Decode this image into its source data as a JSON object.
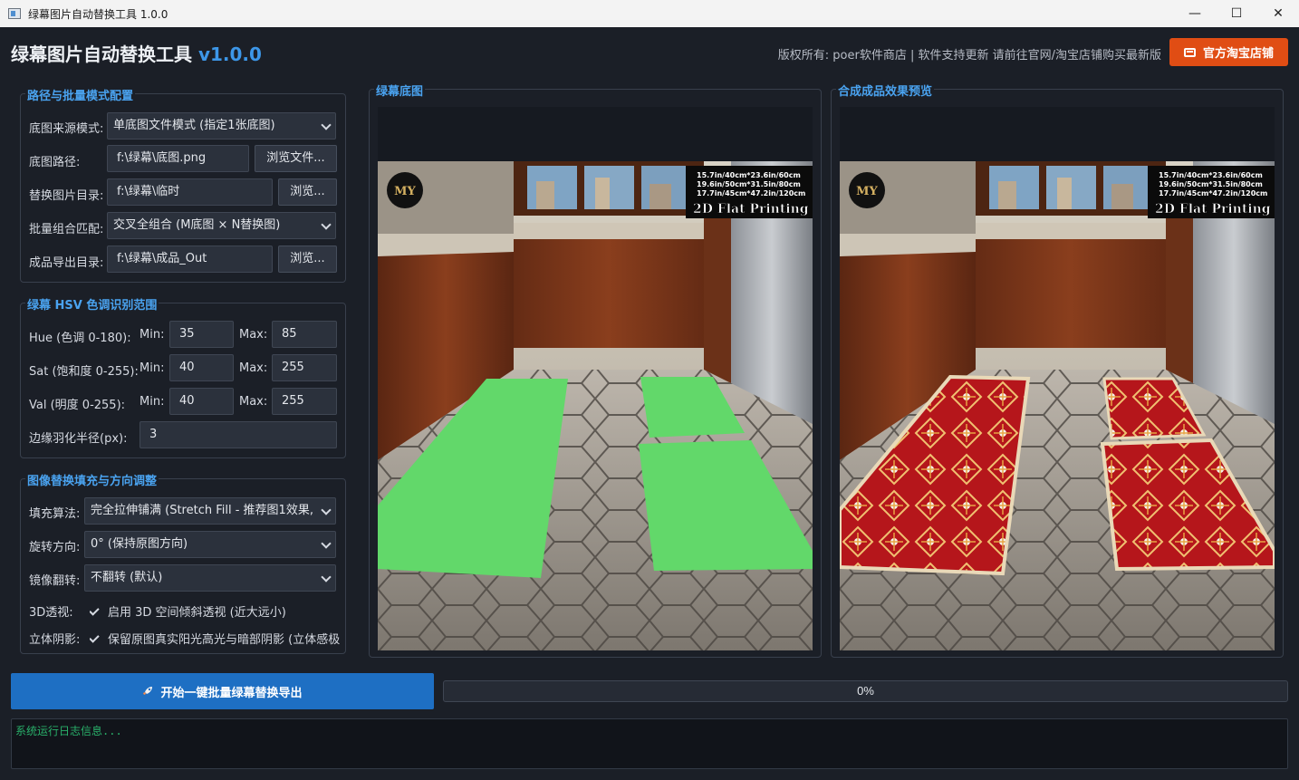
{
  "window": {
    "title": "绿幕图片自动替换工具 1.0.0",
    "controls": {
      "minimize": "—",
      "maximize": "☐",
      "close": "✕"
    }
  },
  "header": {
    "title": "绿幕图片自动替换工具",
    "version": "v1.0.0",
    "copyright": "版权所有: poer软件商店 | 软件支持更新 请前往官网/淘宝店铺购买最新版",
    "shop_button": "官方淘宝店铺",
    "shop_icon": "ticket-icon",
    "accent_color": "#3d97e8",
    "shop_color": "#e04d14"
  },
  "path_config": {
    "title": "路径与批量模式配置",
    "base_mode_label": "底图来源模式:",
    "base_mode_value": "单底图文件模式 (指定1张底图)",
    "base_path_label": "底图路径:",
    "base_path_value": "f:\\绿幕\\底图.png",
    "browse_file_label": "浏览文件...",
    "replace_dir_label": "替换图片目录:",
    "replace_dir_value": "f:\\绿幕\\临时",
    "browse_label": "浏览...",
    "batch_label": "批量组合匹配:",
    "batch_value": "交叉全组合 (M底图 × N替换图)",
    "output_dir_label": "成品导出目录:",
    "output_dir_value": "f:\\绿幕\\成品_Out"
  },
  "hsv": {
    "title": "绿幕 HSV 色调识别范围",
    "min_label": "Min:",
    "max_label": "Max:",
    "hue_label": "Hue (色调 0-180):",
    "hue_min": "35",
    "hue_max": "85",
    "sat_label": "Sat (饱和度 0-255):",
    "sat_min": "40",
    "sat_max": "255",
    "val_label": "Val (明度 0-255):",
    "val_min": "40",
    "val_max": "255",
    "feather_label": "边缘羽化半径(px):",
    "feather_value": "3"
  },
  "fill": {
    "title": "图像替换填充与方向调整",
    "algo_label": "填充算法:",
    "algo_value": "完全拉伸铺满 (Stretch Fill - 推荐图1效果,",
    "rotate_label": "旋转方向:",
    "rotate_value": "0° (保持原图方向)",
    "mirror_label": "镜像翻转:",
    "mirror_value": "不翻转 (默认)",
    "perspective_label": "3D透视:",
    "perspective_check": "启用 3D 空间倾斜透视 (近大远小)",
    "shadow_label": "立体阴影:",
    "shadow_check": "保留原图真实阳光高光与暗部阴影 (立体感极"
  },
  "panels": {
    "source_title": "绿幕底图",
    "preview_title": "合成成品效果预览",
    "badge_logo": "MY",
    "size_line1": "15.7in/40cm*23.6in/60cm",
    "size_line2": "19.6in/50cm*31.5in/80cm",
    "size_line3": "17.7in/45cm*47.2in/120cm",
    "print_label": "2D Flat Printing",
    "green_color": "#62d86a",
    "rug_color": "#b5161b"
  },
  "bottom": {
    "start_button": "开始一键批量绿幕替换导出",
    "start_icon": "rocket-icon",
    "progress_text": "0%",
    "progress_value": 0,
    "log_text": "系统运行日志信息..."
  }
}
